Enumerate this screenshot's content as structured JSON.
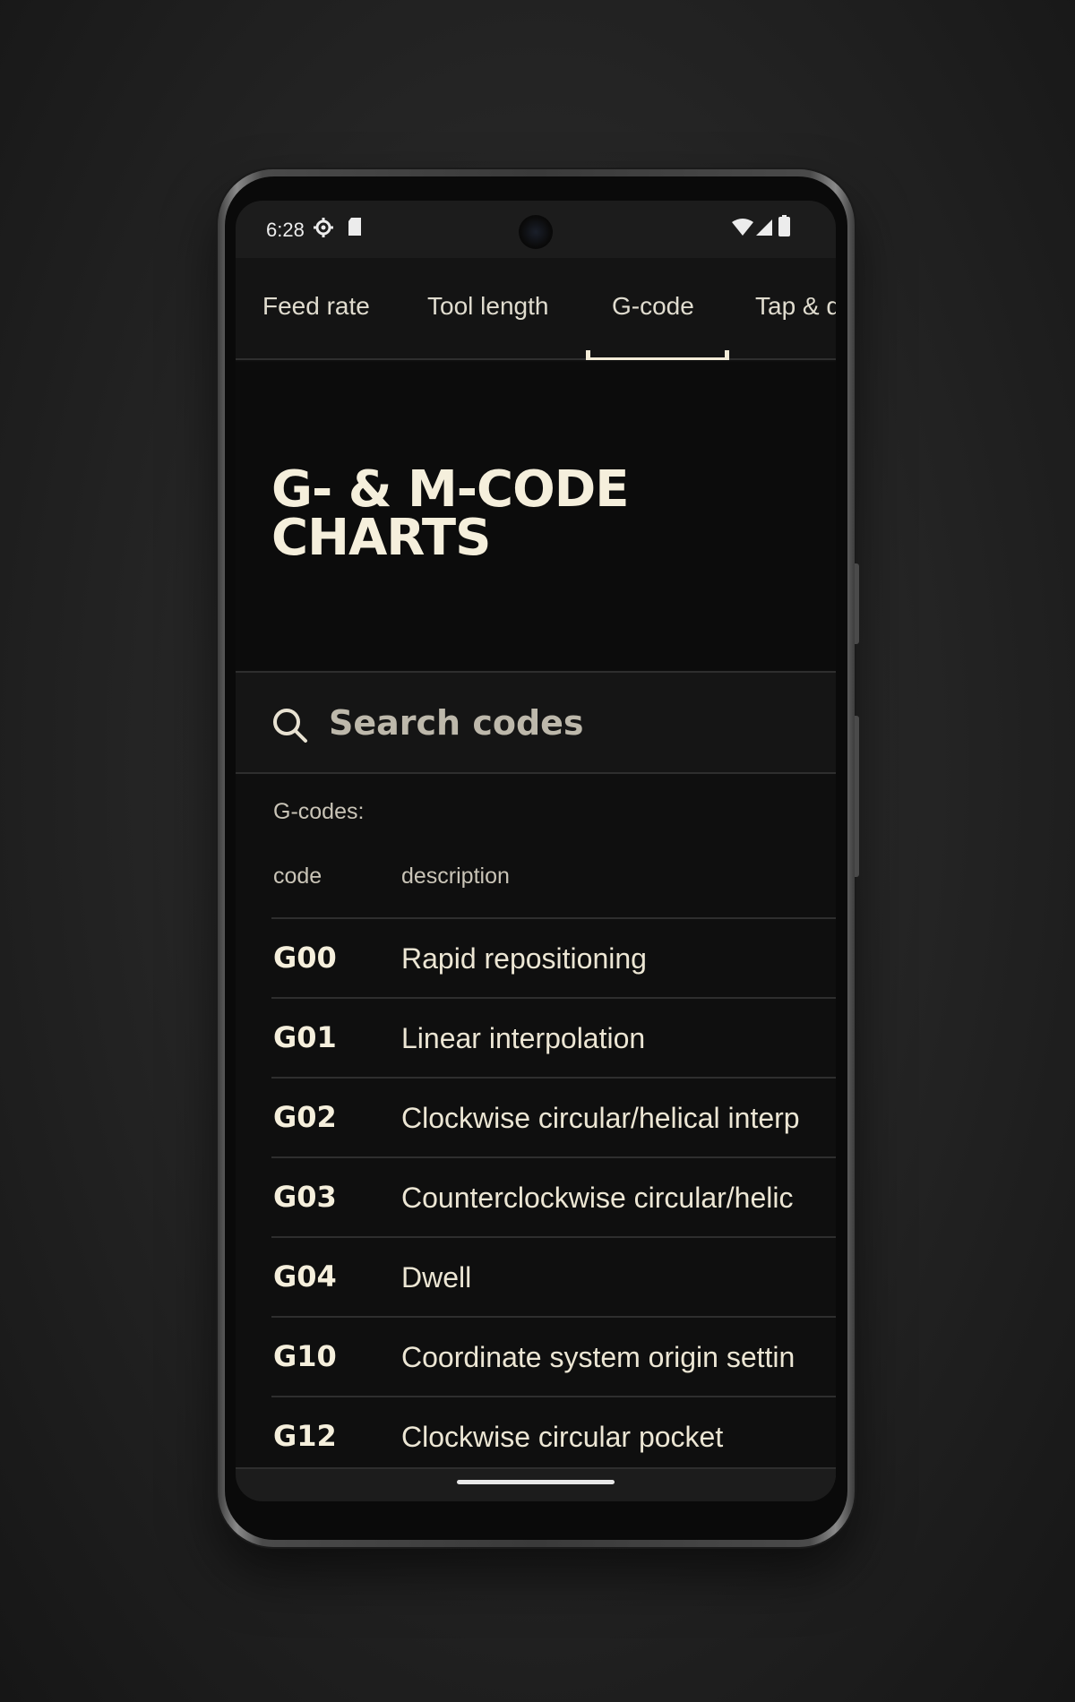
{
  "status_bar": {
    "time": "6:28",
    "icons_left": [
      "gear-icon",
      "sd-card-icon"
    ],
    "icons_right": [
      "wifi-icon",
      "signal-icon",
      "battery-icon"
    ]
  },
  "tabs": [
    {
      "label": "Feed rate",
      "active": false
    },
    {
      "label": "Tool length",
      "active": false
    },
    {
      "label": "G-code",
      "active": true
    },
    {
      "label": "Tap & d",
      "active": false
    }
  ],
  "hero": {
    "title_line1": "G- & M-CODE",
    "title_line2": "CHARTS"
  },
  "search": {
    "placeholder": "Search codes"
  },
  "gcodes": {
    "section_label": "G-codes:",
    "col_code": "code",
    "col_description": "description",
    "rows": [
      {
        "code": "G00",
        "description": "Rapid repositioning"
      },
      {
        "code": "G01",
        "description": "Linear interpolation"
      },
      {
        "code": "G02",
        "description": "Clockwise circular/helical interp"
      },
      {
        "code": "G03",
        "description": "Counterclockwise circular/helic"
      },
      {
        "code": "G04",
        "description": "Dwell"
      },
      {
        "code": "G10",
        "description": "Coordinate system origin settin"
      },
      {
        "code": "G12",
        "description": "Clockwise circular pocket"
      }
    ]
  },
  "colors": {
    "accent": "#f5efdc",
    "background": "#0f0f0f",
    "divider": "#2e2e2e"
  }
}
